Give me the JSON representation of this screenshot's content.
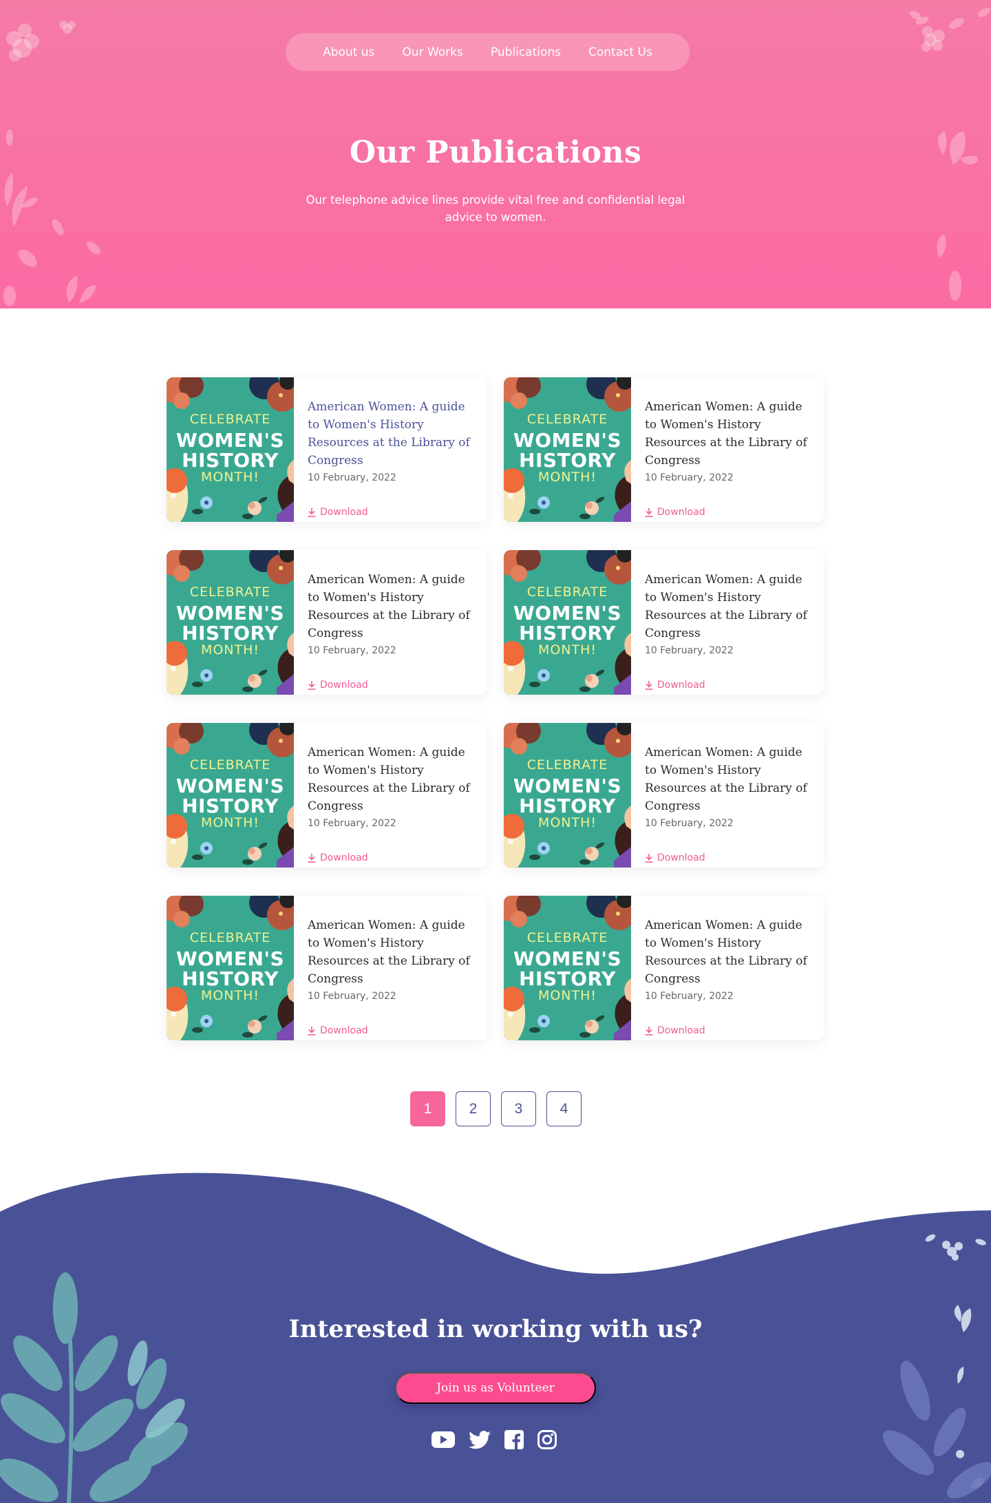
{
  "nav": {
    "items": [
      "About us",
      "Our Works",
      "Publications",
      "Contact Us"
    ]
  },
  "hero": {
    "title": "Our Publications",
    "subtitle": "Our telephone advice lines provide vital free and confidential legal advice to women."
  },
  "thumbnail": {
    "line1": "CELEBRATE",
    "line2": "WOMEN'S",
    "line3": "HISTORY",
    "line4": "MONTH!"
  },
  "publications": [
    {
      "title": "American Women: A guide to Women's History Resources at the Library of Congress",
      "date": "10 February, 2022",
      "download": "Download",
      "active": true
    },
    {
      "title": "American Women: A guide to Women's History Resources at the Library of Congress",
      "date": "10 February, 2022",
      "download": "Download",
      "active": false
    },
    {
      "title": "American Women: A guide to Women's History Resources at the Library of Congress",
      "date": "10 February, 2022",
      "download": "Download",
      "active": false
    },
    {
      "title": "American Women: A guide to Women's History Resources at the Library of Congress",
      "date": "10 February, 2022",
      "download": "Download",
      "active": false
    },
    {
      "title": "American Women: A guide to Women's History Resources at the Library of Congress",
      "date": "10 February, 2022",
      "download": "Download",
      "active": false
    },
    {
      "title": "American Women: A guide to Women's History Resources at the Library of Congress",
      "date": "10 February, 2022",
      "download": "Download",
      "active": false
    },
    {
      "title": "American Women: A guide to Women's History Resources at the Library of Congress",
      "date": "10 February, 2022",
      "download": "Download",
      "active": false
    },
    {
      "title": "American Women: A guide to Women's History Resources at the Library of Congress",
      "date": "10 February, 2022",
      "download": "Download",
      "active": false
    }
  ],
  "pagination": {
    "pages": [
      "1",
      "2",
      "3",
      "4"
    ],
    "current": "1"
  },
  "footer": {
    "cta_title": "Interested in working with us?",
    "cta_button": "Join us as Volunteer",
    "social_icons": [
      "youtube-icon",
      "twitter-icon",
      "facebook-icon",
      "instagram-icon"
    ]
  },
  "colors": {
    "hero_pink": "#f77aa8",
    "accent_pink": "#f05a94",
    "footer_indigo": "#4a5297",
    "thumb_teal": "#3aa891",
    "link_active": "#4a5297"
  }
}
